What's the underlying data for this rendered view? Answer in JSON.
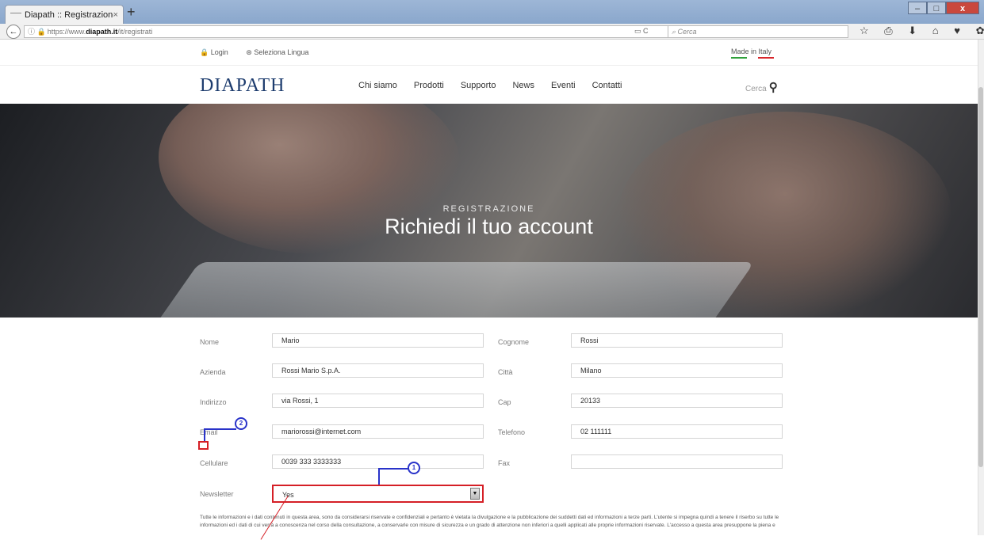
{
  "browser": {
    "tab_title": "Diapath :: Registrazione",
    "tab_close": "×",
    "new_tab": "+",
    "url_prefix": "https://www.",
    "url_domain": "diapath.it",
    "url_path": "/it/registrati",
    "search_placeholder": "Cerca",
    "window_min": "–",
    "window_max": "□",
    "window_close": "x"
  },
  "site": {
    "login": "Login",
    "language": "Seleziona Lingua",
    "made_in_italy": "Made in Italy",
    "logo": "DIAPATH",
    "menu": [
      "Chi siamo",
      "Prodotti",
      "Supporto",
      "News",
      "Eventi",
      "Contatti"
    ],
    "search_label": "Cerca"
  },
  "hero": {
    "subtitle": "REGISTRAZIONE",
    "title": "Richiedi il tuo account"
  },
  "form": {
    "nome": {
      "label": "Nome",
      "value": "Mario"
    },
    "cognome": {
      "label": "Cognome",
      "value": "Rossi"
    },
    "azienda": {
      "label": "Azienda",
      "value": "Rossi Mario S.p.A."
    },
    "citta": {
      "label": "Città",
      "value": "Milano"
    },
    "indirizzo": {
      "label": "Indirizzo",
      "value": "via Rossi, 1"
    },
    "cap": {
      "label": "Cap",
      "value": "20133"
    },
    "email": {
      "label": "Email",
      "value": "mariorossi@internet.com"
    },
    "telefono": {
      "label": "Telefono",
      "value": "02 111111"
    },
    "cellulare": {
      "label": "Cellulare",
      "value": "0039 333 3333333"
    },
    "fax": {
      "label": "Fax",
      "value": ""
    },
    "newsletter": {
      "label": "Newsletter",
      "value": "Yes"
    },
    "legal_text": "Tutte le informazioni e i dati contenuti in questa area, sono da considerarsi riservate e confidenziali e pertanto è vietata la divulgazione e la pubblicazione dei suddetti dati ed informazioni a terze parti. L'utente si impegna quindi a tenere il riserbo su tutte le informazioni ed i dati di cui verrà a conoscenza nel corso della consultazione, a conservarle con misure di sicurezza e un grado di attenzione non inferiori a quelli applicati alle proprie informazioni riservate. L'accesso a questa area presuppone la piena e"
  },
  "annotations": {
    "marker_1": "1",
    "marker_2": "2"
  },
  "colors": {
    "brand_navy": "#1d3c6e",
    "annotation_red": "#d51f26",
    "annotation_blue": "#2933c9"
  }
}
